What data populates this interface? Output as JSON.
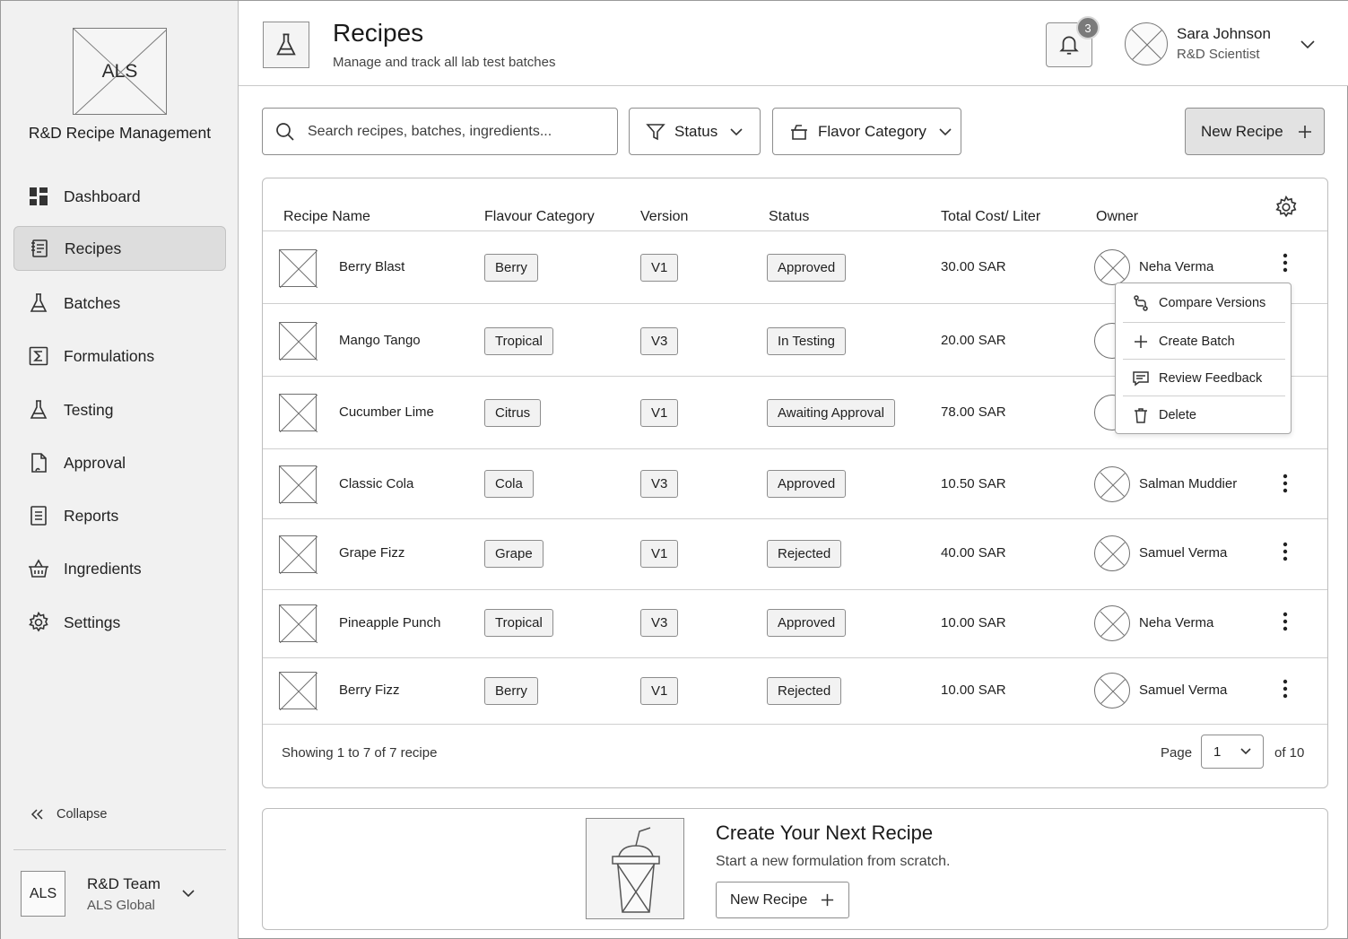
{
  "sidebar": {
    "logo_text": "ALS",
    "app_name": "R&D Recipe Management",
    "items": [
      {
        "label": "Dashboard",
        "icon": "dashboard-icon",
        "active": false
      },
      {
        "label": "Recipes",
        "icon": "recipe-book-icon",
        "active": true
      },
      {
        "label": "Batches",
        "icon": "flask-icon",
        "active": false
      },
      {
        "label": "Formulations",
        "icon": "sigma-icon",
        "active": false
      },
      {
        "label": "Testing",
        "icon": "flask-icon",
        "active": false
      },
      {
        "label": "Approval",
        "icon": "document-check-icon",
        "active": false
      },
      {
        "label": "Reports",
        "icon": "report-icon",
        "active": false
      },
      {
        "label": "Ingredients",
        "icon": "basket-icon",
        "active": false
      },
      {
        "label": "Settings",
        "icon": "gear-icon",
        "active": false
      }
    ],
    "collapse_label": "Collapse",
    "team": {
      "badge": "ALS",
      "name": "R&D Team",
      "org": "ALS Global"
    }
  },
  "header": {
    "title": "Recipes",
    "subtitle": "Manage and track all lab test batches",
    "notification_count": "3",
    "user": {
      "name": "Sara Johnson",
      "role": "R&D Scientist"
    }
  },
  "toolbar": {
    "search_placeholder": "Search recipes, batches, ingredients...",
    "status_filter": "Status",
    "flavor_filter": "Flavor Category",
    "new_recipe_label": "New Recipe"
  },
  "table": {
    "columns": [
      "Recipe Name",
      "Flavour Category",
      "Version",
      "Status",
      "Total Cost/ Liter",
      "Owner"
    ],
    "rows": [
      {
        "name": "Berry Blast",
        "category": "Berry",
        "version": "V1",
        "status": "Approved",
        "cost": "30.00 SAR",
        "owner": "Neha Verma"
      },
      {
        "name": "Mango Tango",
        "category": "Tropical",
        "version": "V3",
        "status": "In Testing",
        "cost": "20.00 SAR",
        "owner": ""
      },
      {
        "name": "Cucumber Lime",
        "category": "Citrus",
        "version": "V1",
        "status": "Awaiting Approval",
        "cost": "78.00 SAR",
        "owner": ""
      },
      {
        "name": "Classic Cola",
        "category": "Cola",
        "version": "V3",
        "status": "Approved",
        "cost": "10.50 SAR",
        "owner": "Salman Muddier"
      },
      {
        "name": "Grape Fizz",
        "category": "Grape",
        "version": "V1",
        "status": "Rejected",
        "cost": "40.00 SAR",
        "owner": "Samuel Verma"
      },
      {
        "name": "Pineapple Punch",
        "category": "Tropical",
        "version": "V3",
        "status": "Approved",
        "cost": "10.00 SAR",
        "owner": "Neha Verma"
      },
      {
        "name": "Berry Fizz",
        "category": "Berry",
        "version": "V1",
        "status": "Rejected",
        "cost": "10.00 SAR",
        "owner": "Samuel Verma"
      }
    ],
    "footer": {
      "showing": "Showing 1 to 7  of 7 recipe",
      "page_label": "Page",
      "page_value": "1",
      "page_of": "of 10"
    }
  },
  "context_menu": {
    "items": [
      {
        "label": "Compare Versions",
        "icon": "compare-icon"
      },
      {
        "label": "Create Batch",
        "icon": "plus-icon"
      },
      {
        "label": "Review Feedback",
        "icon": "comment-icon"
      },
      {
        "label": "Delete",
        "icon": "trash-icon"
      }
    ]
  },
  "promo": {
    "title": "Create Your Next Recipe",
    "subtitle": "Start a new formulation from scratch.",
    "button_label": "New Recipe"
  },
  "colors": {
    "sidebar_bg": "#f1f1f1",
    "active_nav": "#dddddd",
    "border": "#8d8d8d",
    "badge": "#7a7a7a"
  }
}
